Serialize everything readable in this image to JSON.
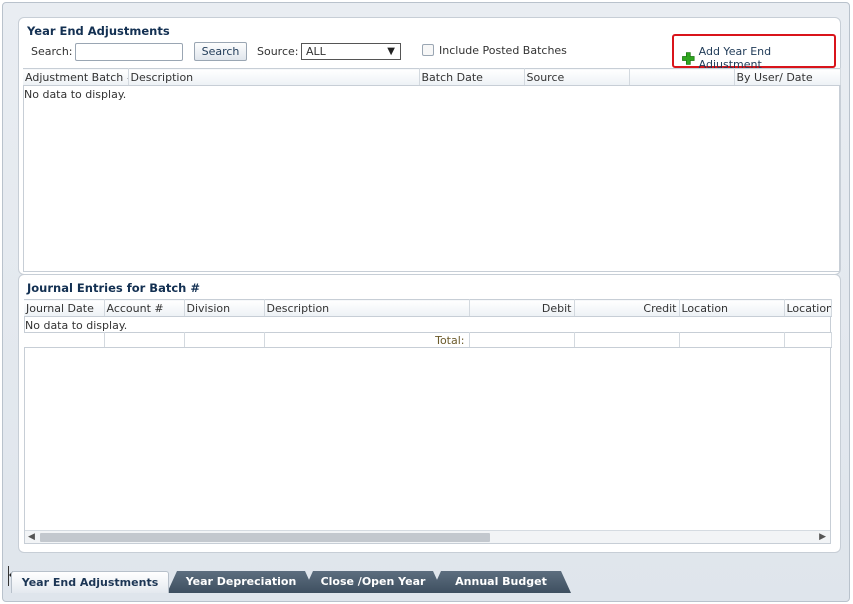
{
  "top_panel": {
    "title": "Year End Adjustments",
    "search_label": "Search:",
    "search_value": "",
    "search_button": "Search",
    "source_label": "Source:",
    "source_value": "ALL",
    "include_posted_label": "Include Posted Batches",
    "include_posted_checked": false,
    "add_button_label": "Add Year End Adjustment",
    "columns": [
      "Adjustment Batch #",
      "Description",
      "Batch Date",
      "Source",
      "",
      "By User/ Date"
    ],
    "empty_message": "No data to display."
  },
  "bottom_panel": {
    "title": "Journal Entries for Batch #",
    "columns": [
      "Journal Date",
      "Account #",
      "Division",
      "Description",
      "Debit",
      "Credit",
      "Location",
      "Location"
    ],
    "empty_message": "No data to display.",
    "total_label": "Total:"
  },
  "tabs": [
    {
      "label": "Year End Adjustments",
      "active": true
    },
    {
      "label": "Year Depreciation",
      "active": false
    },
    {
      "label": "Close /Open Year",
      "active": false
    },
    {
      "label": "Annual Budget",
      "active": false
    }
  ],
  "icons": {
    "add": "plus-icon",
    "dropdown": "chevron-down-icon",
    "scroll_left": "arrow-left-icon",
    "scroll_right": "arrow-right-icon"
  },
  "colors": {
    "title": "#133052",
    "highlight_border": "#d9141b",
    "plus_icon": "#2fa51f",
    "tab_dark": "#4a5b6c"
  }
}
